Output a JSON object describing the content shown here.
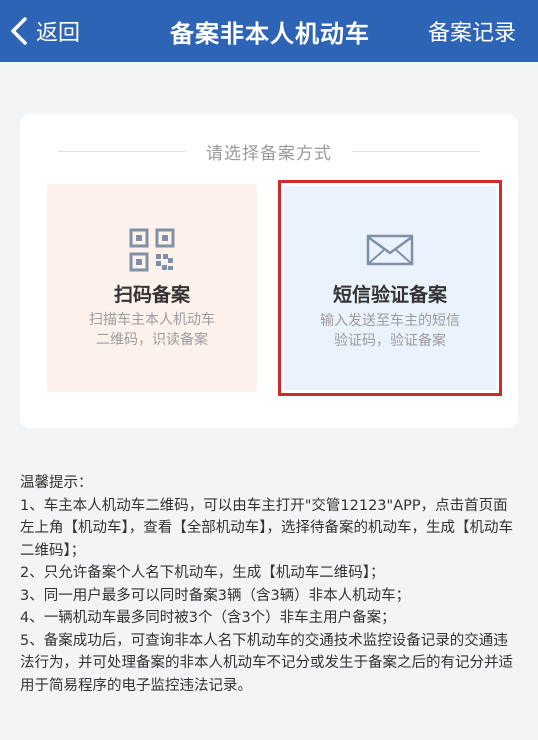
{
  "header": {
    "back_label": "返回",
    "title": "备案非本人机动车",
    "records_label": "备案记录",
    "bar_color": "#2e64b6"
  },
  "choose": {
    "label": "请选择备案方式"
  },
  "options": {
    "scan": {
      "icon": "qr-code-icon",
      "title": "扫码备案",
      "desc_line1": "扫描车主本人机动车",
      "desc_line2": "二维码，识读备案"
    },
    "sms": {
      "icon": "envelope-icon",
      "title": "短信验证备案",
      "desc_line1": "输入发送至车主的短信",
      "desc_line2": "验证码，验证备案",
      "highlight_color": "#cc2b2b"
    }
  },
  "tips": {
    "heading": "温馨提示：",
    "items": [
      "1、车主本人机动车二维码，可以由车主打开\"交管12123\"APP，点击首页面左上角【机动车】，查看【全部机动车】，选择待备案的机动车，生成【机动车二维码】；",
      "2、只允许备案个人名下机动车，生成【机动车二维码】；",
      "3、同一用户最多可以同时备案3辆（含3辆）非本人机动车；",
      "4、一辆机动车最多同时被3个（含3个）非车主用户备案；",
      "5、备案成功后，可查询非本人名下机动车的交通技术监控设备记录的交通违法行为，并可处理备案的非本人机动车不记分或发生于备案之后的有记分并适用于简易程序的电子监控违法记录。"
    ]
  }
}
